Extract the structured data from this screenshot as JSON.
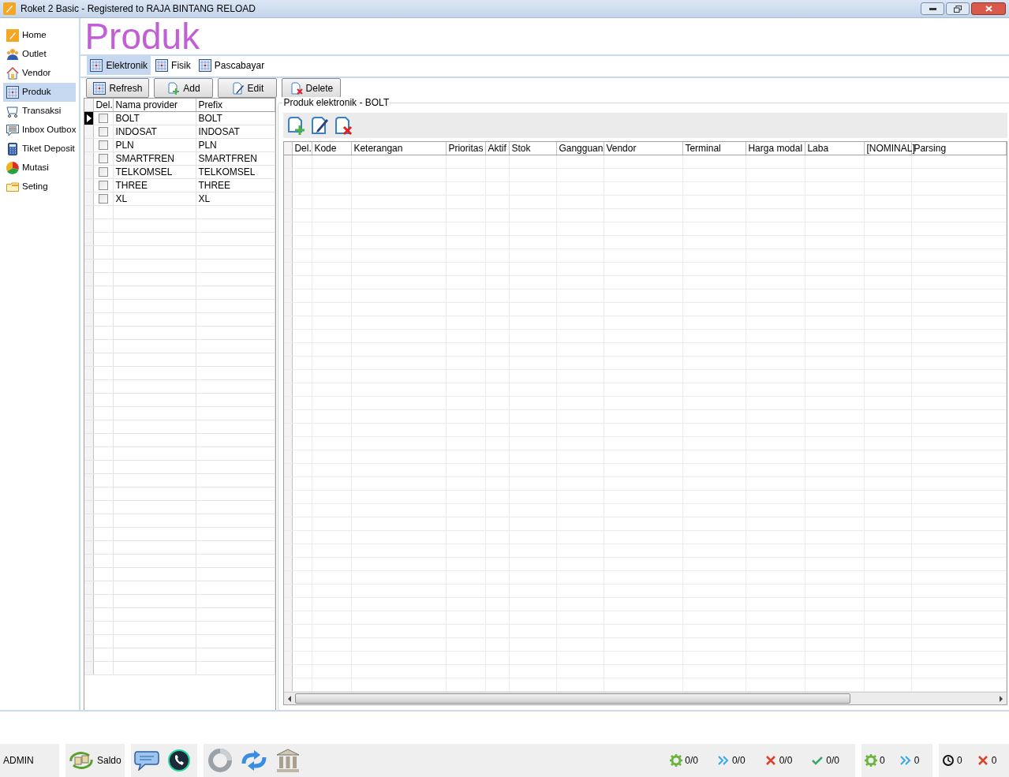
{
  "window": {
    "title": "Roket 2 Basic - Registered to RAJA BINTANG RELOAD"
  },
  "sidebar": {
    "items": [
      {
        "label": "Home",
        "selected": false
      },
      {
        "label": "Outlet",
        "selected": false
      },
      {
        "label": "Vendor",
        "selected": false
      },
      {
        "label": "Produk",
        "selected": true
      },
      {
        "label": "Transaksi",
        "selected": false
      },
      {
        "label": "Inbox Outbox",
        "selected": false
      },
      {
        "label": "Tiket Deposit",
        "selected": false
      },
      {
        "label": "Mutasi",
        "selected": false
      },
      {
        "label": "Seting",
        "selected": false
      }
    ]
  },
  "page_title": "Produk",
  "tabs": [
    {
      "label": "Elektronik",
      "selected": true
    },
    {
      "label": "Fisik",
      "selected": false
    },
    {
      "label": "Pascabayar",
      "selected": false
    }
  ],
  "toolbar": [
    {
      "label": "Refresh"
    },
    {
      "label": "Add"
    },
    {
      "label": "Edit"
    },
    {
      "label": "Delete"
    }
  ],
  "provider_table": {
    "columns": [
      "Del.",
      "Nama provider",
      "Prefix"
    ],
    "rows": [
      {
        "checked": false,
        "selected": true,
        "name": "BOLT",
        "prefix": "BOLT"
      },
      {
        "checked": false,
        "selected": false,
        "name": "INDOSAT",
        "prefix": "INDOSAT"
      },
      {
        "checked": false,
        "selected": false,
        "name": "PLN",
        "prefix": "PLN"
      },
      {
        "checked": false,
        "selected": false,
        "name": "SMARTFREN",
        "prefix": "SMARTFREN"
      },
      {
        "checked": false,
        "selected": false,
        "name": "TELKOMSEL",
        "prefix": "TELKOMSEL"
      },
      {
        "checked": false,
        "selected": false,
        "name": "THREE",
        "prefix": "THREE"
      },
      {
        "checked": false,
        "selected": false,
        "name": "XL",
        "prefix": "XL"
      }
    ]
  },
  "product_panel": {
    "title": "Produk elektronik - BOLT",
    "columns": [
      "Del.",
      "Kode",
      "Keterangan",
      "Prioritas",
      "Aktif",
      "Stok",
      "Gangguan",
      "Vendor",
      "Terminal",
      "Harga modal",
      "Laba",
      "[NOMINAL]",
      "Parsing"
    ]
  },
  "status_bar": {
    "user": "ADMIN",
    "saldo": "Saldo",
    "counters_a": [
      {
        "kind": "gear",
        "text": "0/0"
      },
      {
        "kind": "forward",
        "text": "0/0"
      },
      {
        "kind": "cross",
        "text": "0/0"
      },
      {
        "kind": "check",
        "text": "0/0"
      }
    ],
    "counters_b": [
      {
        "kind": "gear",
        "text": "0"
      },
      {
        "kind": "forward",
        "text": "0"
      }
    ],
    "counters_c": [
      {
        "kind": "clock",
        "text": "0"
      },
      {
        "kind": "cross",
        "text": "0"
      }
    ]
  }
}
